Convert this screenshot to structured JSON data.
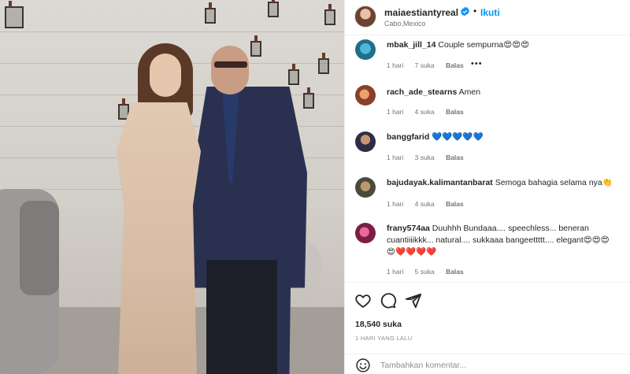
{
  "header": {
    "username": "maiaestiantyreal",
    "verified_icon": "verified-badge-icon",
    "separator": "•",
    "follow_label": "Ikuti",
    "location": "Cabo,Mexico"
  },
  "colors": {
    "link": "#0095f6",
    "verified": "#0095f6",
    "meta": "#737373"
  },
  "comments": [
    {
      "user": "mbak_jill_14",
      "text": "Couple sempurna😍😍😍",
      "time": "1 hari",
      "likes": "7 suka",
      "reply": "Balas",
      "more": "•••"
    },
    {
      "user": "rach_ade_stearns",
      "text": "Amen",
      "time": "1 hari",
      "likes": "4 suka",
      "reply": "Balas"
    },
    {
      "user": "banggfarid",
      "text": "💙💙💙💙💙",
      "time": "1 hari",
      "likes": "3 suka",
      "reply": "Balas"
    },
    {
      "user": "bajudayak.kalimantanbarat",
      "text": "Semoga bahagia selama nya👏",
      "time": "1 hari",
      "likes": "4 suka",
      "reply": "Balas"
    },
    {
      "user": "frany574aa",
      "text": "Duuhhh Bundaaa.... speechless... beneran cuantiiiikkk... natural.... sukkaaa bangeettttt.... elegant😍😍😍 😍❤️❤️❤️❤️",
      "time": "1 hari",
      "likes": "5 suka",
      "reply": "Balas"
    }
  ],
  "actions": {
    "like_icon": "heart-icon",
    "comment_icon": "comment-icon",
    "share_icon": "share-icon",
    "likes_count": "18,540 suka",
    "date": "1 HARI YANG LALU"
  },
  "add_comment": {
    "emoji_icon": "emoji-icon",
    "placeholder": "Tambahkan komentar..."
  }
}
